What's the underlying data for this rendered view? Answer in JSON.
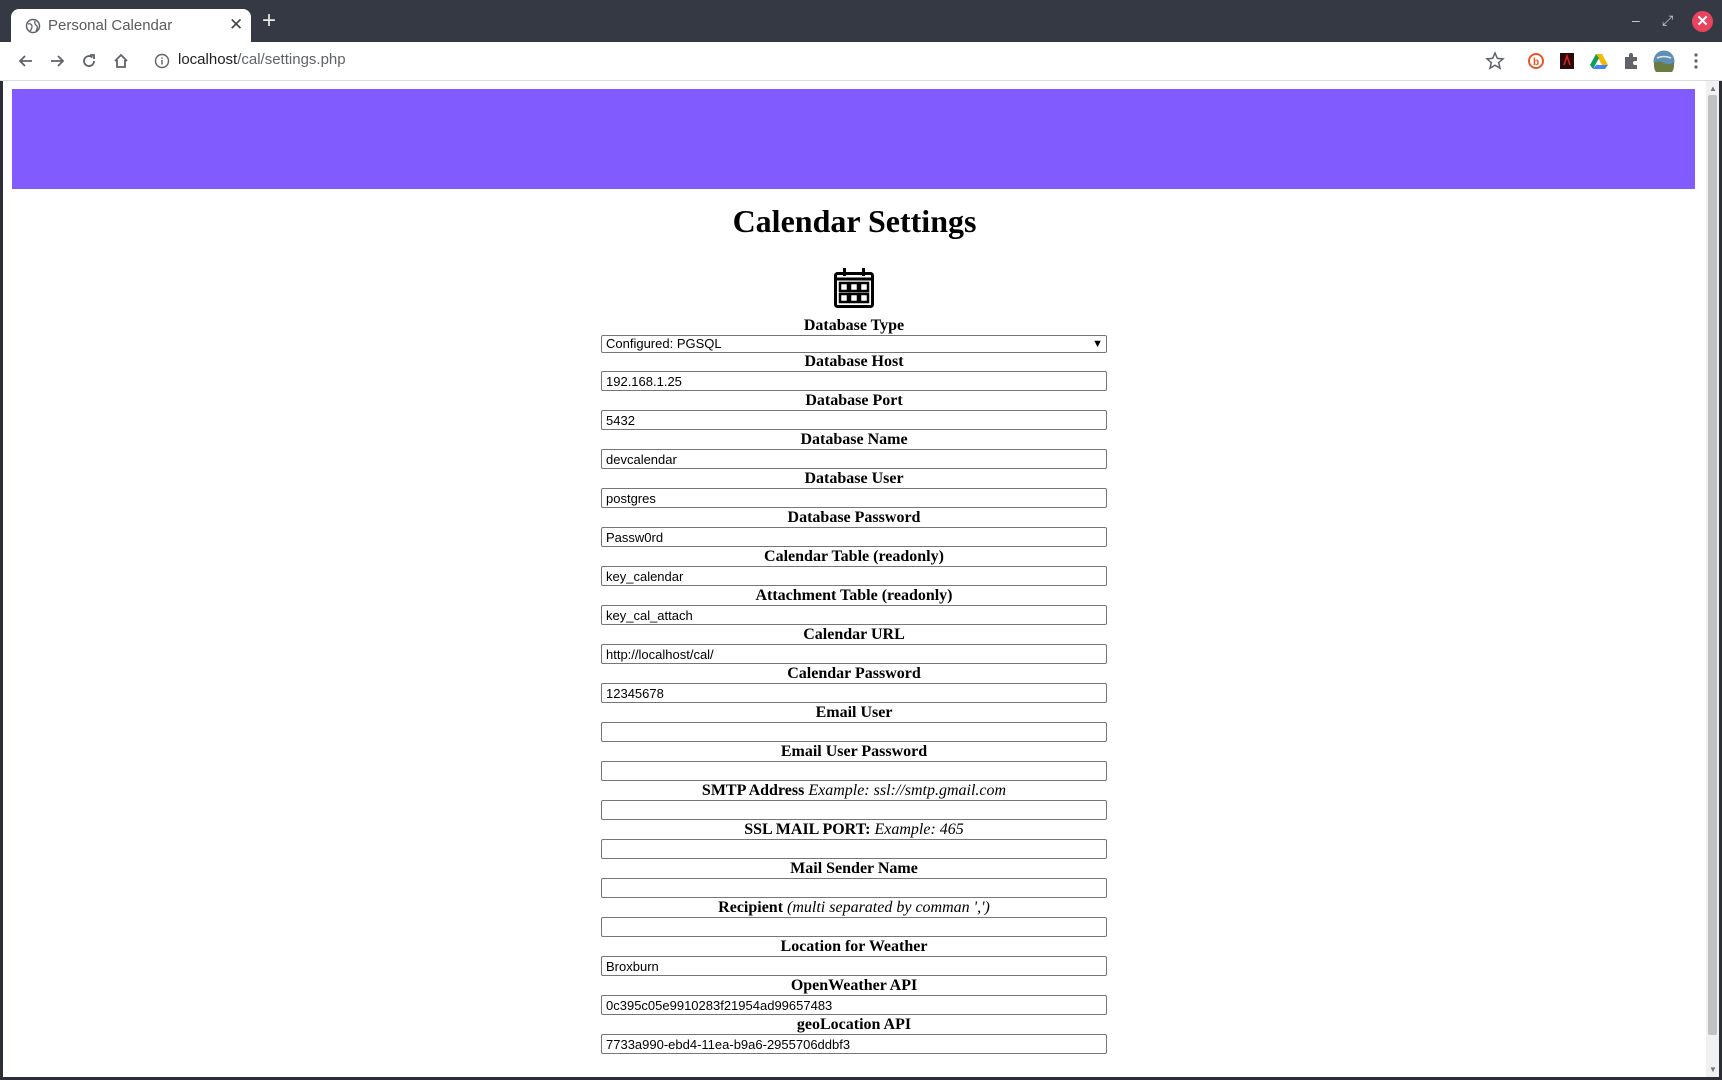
{
  "browser": {
    "tab_title": "Personal Calendar",
    "new_tab_symbol": "+",
    "url_host": "localhost",
    "url_path": "/cal/settings.php"
  },
  "page": {
    "title": "Calendar Settings",
    "banner_color": "#815bfe"
  },
  "form": {
    "database_type": {
      "label": "Database Type",
      "value": "Configured: PGSQL"
    },
    "database_host": {
      "label": "Database Host",
      "value": "192.168.1.25"
    },
    "database_port": {
      "label": "Database Port",
      "value": "5432"
    },
    "database_name": {
      "label": "Database Name",
      "value": "devcalendar"
    },
    "database_user": {
      "label": "Database User",
      "value": "postgres"
    },
    "database_password": {
      "label": "Database Password",
      "value": "Passw0rd"
    },
    "calendar_table": {
      "label": "Calendar Table (readonly)",
      "value": "key_calendar"
    },
    "attachment_table": {
      "label": "Attachment Table (readonly)",
      "value": "key_cal_attach"
    },
    "calendar_url": {
      "label": "Calendar URL",
      "value": "http://localhost/cal/"
    },
    "calendar_password": {
      "label": "Calendar Password",
      "value": "12345678"
    },
    "email_user": {
      "label": "Email User",
      "value": ""
    },
    "email_user_password": {
      "label": "Email User Password",
      "value": ""
    },
    "smtp_address": {
      "label": "SMTP Address",
      "hint": "Example: ssl://smtp.gmail.com",
      "value": ""
    },
    "ssl_mail_port": {
      "label": "SSL MAIL PORT:",
      "hint": "Example: 465",
      "value": ""
    },
    "mail_sender_name": {
      "label": "Mail Sender Name",
      "value": ""
    },
    "recipient": {
      "label": "Recipient",
      "hint": "(multi separated by comman ',')",
      "value": ""
    },
    "weather_location": {
      "label": "Location for Weather",
      "value": "Broxburn"
    },
    "openweather_api": {
      "label": "OpenWeather API",
      "value": "0c395c05e9910283f21954ad99657483"
    },
    "geolocation_api": {
      "label": "geoLocation API",
      "value": "7733a990-ebd4-11ea-b9a6-2955706ddbf3"
    }
  },
  "icons": [
    "globe-icon",
    "close-icon",
    "back-icon",
    "forward-icon",
    "reload-icon",
    "home-icon",
    "info-icon",
    "star-icon",
    "extensions-icon",
    "menu-icon",
    "calendar-icon",
    "chevron-down-icon"
  ]
}
